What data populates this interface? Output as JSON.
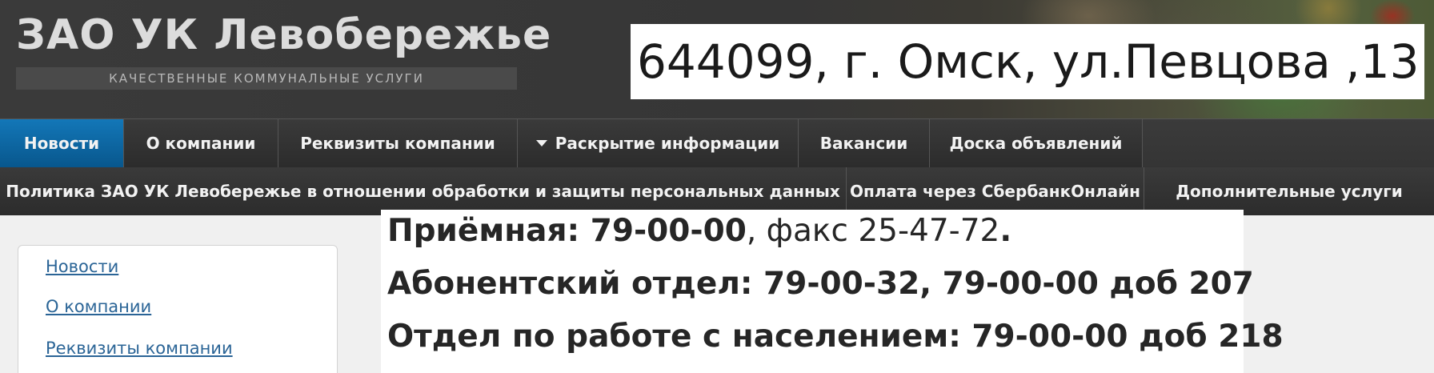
{
  "header": {
    "site_title": "ЗАО УК Левобережье",
    "tagline": "КАЧЕСТВЕННЫЕ КОММУНАЛЬНЫЕ УСЛУГИ",
    "address": "644099, г. Омск, ул.Певцова ,13"
  },
  "nav": {
    "row1": [
      {
        "label": "Новости",
        "active": true
      },
      {
        "label": "О компании"
      },
      {
        "label": "Реквизиты компании"
      },
      {
        "label": "Раскрытие информации",
        "dropdown": true
      },
      {
        "label": "Вакансии"
      },
      {
        "label": "Доска объявлений"
      }
    ],
    "row2": [
      {
        "label": "Политика ЗАО УК Левобережье в отношении обработки и защиты персональных данных"
      },
      {
        "label": "Оплата через СбербанкОнлайн"
      },
      {
        "label": "Дополнительные услуги"
      }
    ]
  },
  "sidebar": {
    "links": [
      "Новости",
      "О компании",
      "Реквизиты компании"
    ]
  },
  "contacts": {
    "reception_label": "Приёмная: 79-00-00",
    "fax": ", факс 25-47-72",
    "fax_end": ".",
    "subscriber": "Абонентский отдел: 79-00-32, 79-00-00 доб 207",
    "population": "Отдел по работе с населением: 79-00-00 доб 218"
  },
  "colors": {
    "active_nav": "#0a6aa8",
    "link": "#2a6496"
  }
}
